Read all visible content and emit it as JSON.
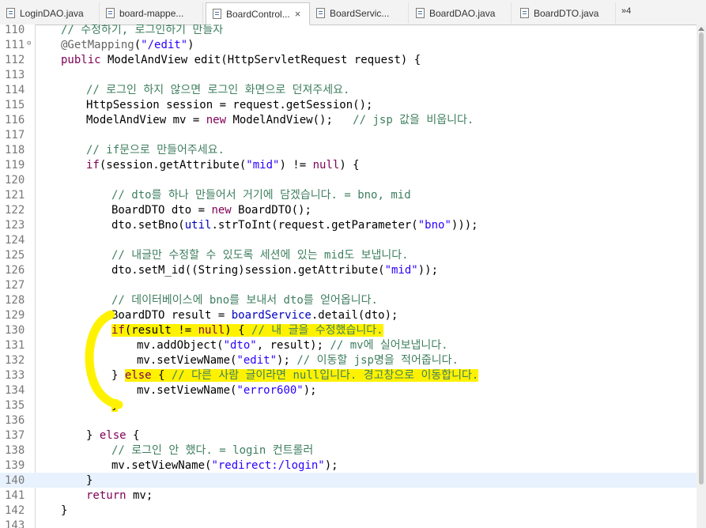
{
  "tabs": [
    {
      "label": "LoginDAO.java",
      "active": false
    },
    {
      "label": "board-mappe...",
      "active": false
    },
    {
      "label": "BoardControl...",
      "active": true
    },
    {
      "label": "BoardServic...",
      "active": false
    },
    {
      "label": "BoardDAO.java",
      "active": false
    },
    {
      "label": "BoardDTO.java",
      "active": false
    }
  ],
  "tab_close_glyph": "×",
  "overflow_label": "»4",
  "colors": {
    "keyword": "#7f0055",
    "comment": "#3f7f5f",
    "string": "#2a00ff",
    "highlight": "#fff200",
    "current_line": "#e8f2fe"
  },
  "lines": [
    {
      "n": "110",
      "s": [
        [
          "cm",
          "// 수정하기, 로그인하기 만들자"
        ]
      ]
    },
    {
      "n": "111",
      "s": [
        [
          "an",
          "@GetMapping"
        ],
        [
          "",
          "("
        ],
        [
          "st",
          "\"/edit\""
        ],
        [
          "",
          ")"
        ]
      ]
    },
    {
      "n": "112",
      "s": [
        [
          "kw",
          "public"
        ],
        [
          "",
          " ModelAndView edit(HttpServletRequest request) {"
        ]
      ]
    },
    {
      "n": "113",
      "s": []
    },
    {
      "n": "114",
      "s": [
        [
          "cm",
          "// 로그인 하지 않으면 로그인 화면으로 던져주세요."
        ]
      ]
    },
    {
      "n": "115",
      "s": [
        [
          "",
          "HttpSession session = request.getSession();"
        ]
      ]
    },
    {
      "n": "116",
      "s": [
        [
          "",
          "ModelAndView mv = "
        ],
        [
          "kw",
          "new"
        ],
        [
          "",
          " ModelAndView();   "
        ],
        [
          "cm",
          "// jsp 값을 비웁니다."
        ]
      ]
    },
    {
      "n": "117",
      "s": []
    },
    {
      "n": "118",
      "s": [
        [
          "cm",
          "// if문으로 만들어주세요."
        ]
      ]
    },
    {
      "n": "119",
      "s": [
        [
          "kw",
          "if"
        ],
        [
          "",
          "(session.getAttribute("
        ],
        [
          "st",
          "\"mid\""
        ],
        [
          "",
          ") != "
        ],
        [
          "kw",
          "null"
        ],
        [
          "",
          ") {"
        ]
      ]
    },
    {
      "n": "120",
      "s": []
    },
    {
      "n": "121",
      "s": [
        [
          "cm",
          "// dto를 하나 만들어서 거기에 담겠습니다. = bno, mid"
        ]
      ]
    },
    {
      "n": "122",
      "s": [
        [
          "",
          "BoardDTO dto = "
        ],
        [
          "kw",
          "new"
        ],
        [
          "",
          " BoardDTO();"
        ]
      ]
    },
    {
      "n": "123",
      "s": [
        [
          "",
          "dto.setBno("
        ],
        [
          "fl",
          "util"
        ],
        [
          "",
          ".strToInt(request.getParameter("
        ],
        [
          "st",
          "\"bno\""
        ],
        [
          "",
          ")));"
        ]
      ]
    },
    {
      "n": "124",
      "s": []
    },
    {
      "n": "125",
      "s": [
        [
          "cm",
          "// 내글만 수정할 수 있도록 세션에 있는 mid도 보냅니다."
        ]
      ]
    },
    {
      "n": "126",
      "s": [
        [
          "",
          "dto.setM_id((String)session.getAttribute("
        ],
        [
          "st",
          "\"mid\""
        ],
        [
          "",
          "));"
        ]
      ]
    },
    {
      "n": "127",
      "s": []
    },
    {
      "n": "128",
      "s": [
        [
          "cm",
          "// 데이터베이스에 bno를 보내서 dto를 얻어옵니다."
        ]
      ]
    },
    {
      "n": "129",
      "s": [
        [
          "",
          "BoardDTO result = "
        ],
        [
          "fl",
          "boardService"
        ],
        [
          "",
          ".detail(dto);"
        ]
      ]
    },
    {
      "n": "130",
      "s": [
        [
          "kw",
          "if"
        ],
        [
          "",
          "(result != "
        ],
        [
          "kw",
          "null"
        ],
        [
          "",
          ") { "
        ],
        [
          "cm",
          "// 내 글을 수정했습니다."
        ]
      ]
    },
    {
      "n": "131",
      "s": [
        [
          "",
          "mv.addObject("
        ],
        [
          "st",
          "\"dto\""
        ],
        [
          "",
          ", result); "
        ],
        [
          "cm",
          "// mv에 실어보냅니다."
        ]
      ]
    },
    {
      "n": "132",
      "s": [
        [
          "",
          "mv.setViewName("
        ],
        [
          "st",
          "\"edit\""
        ],
        [
          "",
          "); "
        ],
        [
          "cm",
          "// 이동할 jsp명을 적어줍니다."
        ]
      ]
    },
    {
      "n": "133",
      "s": [
        [
          "",
          "} "
        ],
        [
          "kw",
          "else"
        ],
        [
          "",
          " { "
        ],
        [
          "cm",
          "// 다른 사람 글이라면 null입니다. 경고창으로 이동합니다."
        ]
      ]
    },
    {
      "n": "134",
      "s": [
        [
          "",
          "mv.setViewName("
        ],
        [
          "st",
          "\"error600\""
        ],
        [
          "",
          ");"
        ]
      ]
    },
    {
      "n": "135",
      "s": [
        [
          "",
          "}"
        ]
      ]
    },
    {
      "n": "136",
      "s": []
    },
    {
      "n": "137",
      "s": [
        [
          "",
          "} "
        ],
        [
          "kw",
          "else"
        ],
        [
          "",
          " {"
        ]
      ]
    },
    {
      "n": "138",
      "s": [
        [
          "cm",
          "// 로그인 안 했다. = login 컨트롤러"
        ]
      ]
    },
    {
      "n": "139",
      "s": [
        [
          "",
          "mv.setViewName("
        ],
        [
          "st",
          "\"redirect:/login\""
        ],
        [
          "",
          ");"
        ]
      ]
    },
    {
      "n": "140",
      "s": [
        [
          "",
          "}"
        ]
      ]
    },
    {
      "n": "141",
      "s": [
        [
          "kw",
          "return"
        ],
        [
          "",
          " mv;"
        ]
      ]
    },
    {
      "n": "142",
      "s": [
        [
          "",
          "}"
        ]
      ]
    },
    {
      "n": "143",
      "s": []
    }
  ]
}
